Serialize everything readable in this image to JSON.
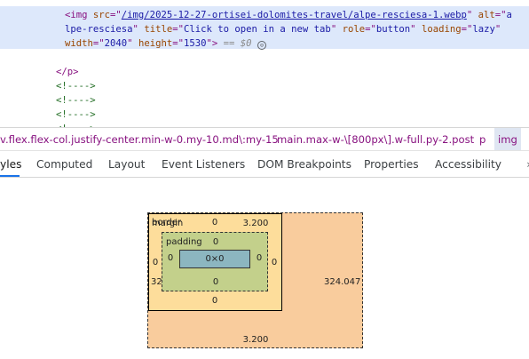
{
  "dom_tree": {
    "line_top": "<!---->",
    "img_line": {
      "open": "<img ",
      "src_name": "src",
      "src_value": "/img/2025-12-27-ortisei-dolomites-travel/alpe-resciesa-1.webp",
      "alt_name": "alt",
      "alt_value_start": "a",
      "alt_value_cont": "lpe-resciesa",
      "title_name": "title",
      "title_value": "Click to open in a new tab",
      "role_name": "role",
      "role_value": "button",
      "loading_name": "loading",
      "loading_value": "lazy",
      "width_name": "width",
      "width_value": "2040",
      "height_name": "height",
      "height_value": "1530",
      "eq_marker": "== $0"
    },
    "p_close": "</p>",
    "comments": [
      "<!---->",
      "<!---->",
      "<!---->",
      "<!---->"
    ]
  },
  "breadcrumb": {
    "items": [
      "v.flex.flex-col.justify-center.min-w-0.my-10.md\\:my-15",
      "main.max-w-\\[800px\\].w-full.py-2.post",
      "p",
      "img"
    ]
  },
  "tabs": {
    "items": [
      "yles",
      "Computed",
      "Layout",
      "Event Listeners",
      "DOM Breakpoints",
      "Properties",
      "Accessibility"
    ],
    "active_index": 0
  },
  "box_model": {
    "margin_label": "margin",
    "margin_top": "3.200",
    "margin_bottom": "3.200",
    "margin_left": "324.047",
    "margin_right": "324.047",
    "border_label": "border",
    "border_top": "0",
    "border_bottom": "0",
    "border_left": "0",
    "border_right": "0",
    "padding_label": "padding",
    "padding_top": "0",
    "padding_bottom": "0",
    "padding_left": "0",
    "padding_right": "0",
    "content_size": "0×0",
    "colors": {
      "margin": "#f9cc9d",
      "border": "#fddd9b",
      "padding": "#c3d08b",
      "content": "#8cb6c0"
    }
  }
}
